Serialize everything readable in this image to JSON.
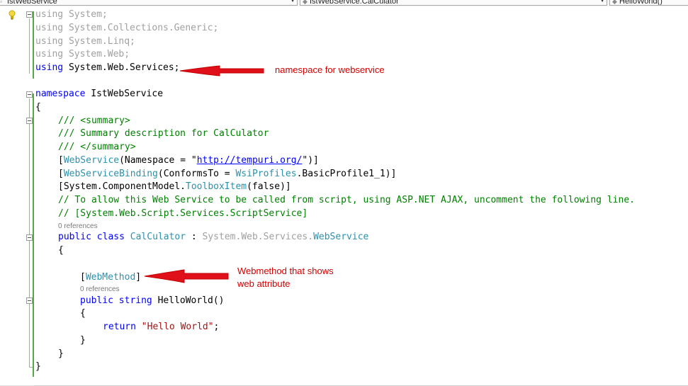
{
  "navigation_bar": {
    "project_dropdown": "IstWebService",
    "class_dropdown": "IstWebService.CalCulator",
    "member_dropdown": "HelloWorld()"
  },
  "code": {
    "using1": {
      "kw": "using",
      "ns": "System;"
    },
    "using2": {
      "kw": "using",
      "ns": "System.Collections.Generic;"
    },
    "using3": {
      "kw": "using",
      "ns": "System.Linq;"
    },
    "using4": {
      "kw": "using",
      "ns": "System.Web;"
    },
    "using5": {
      "kw": "using",
      "ns": "System.Web.Services;"
    },
    "ns_kw": "namespace",
    "ns_name": "IstWebService",
    "open_brace": "{",
    "close_brace": "}",
    "summary_open": "/// <summary>",
    "summary_desc": "/// Summary description for CalCulator",
    "summary_close": "/// </summary>",
    "attr1": {
      "open": "[",
      "type": "WebService",
      "mid": "(Namespace = \"",
      "url": "http://tempuri.org/",
      "end": "\")]"
    },
    "attr2": {
      "open": "[",
      "type": "WebServiceBinding",
      "mid": "(ConformsTo = ",
      "type2": "WsiProfiles",
      "end": ".BasicProfile1_1)]"
    },
    "attr3": {
      "open": "[System.ComponentModel.",
      "type": "ToolboxItem",
      "end": "(false)]"
    },
    "comment1": "// To allow this Web Service to be called from script, using ASP.NET AJAX, uncomment the following line.",
    "comment2": "// [System.Web.Script.Services.ScriptService]",
    "class_refs": "0 references",
    "class_kw1": "public",
    "class_kw2": "class",
    "class_name": "CalCulator",
    "class_colon": " : ",
    "class_base_ns": "System.Web.Services.",
    "class_base": "WebService",
    "webmethod": {
      "open": "[",
      "type": "WebMethod",
      "end": "]"
    },
    "method_refs": "0 references",
    "method_kw1": "public",
    "method_kw2": "string",
    "method_name": "HelloWorld()",
    "return_kw": "return",
    "return_str": "\"Hello World\"",
    "return_end": ";"
  },
  "annotations": {
    "note1": "namespace for webservice",
    "note2_line1": "Webmethod that shows",
    "note2_line2": "web attribute"
  },
  "colors": {
    "keyword": "#0000ff",
    "comment": "#008000",
    "type": "#2b91af",
    "string": "#a31515",
    "annotation": "#d40000",
    "change_bar_saved": "#57a64a",
    "change_bar_unsaved": "#f2c511"
  }
}
